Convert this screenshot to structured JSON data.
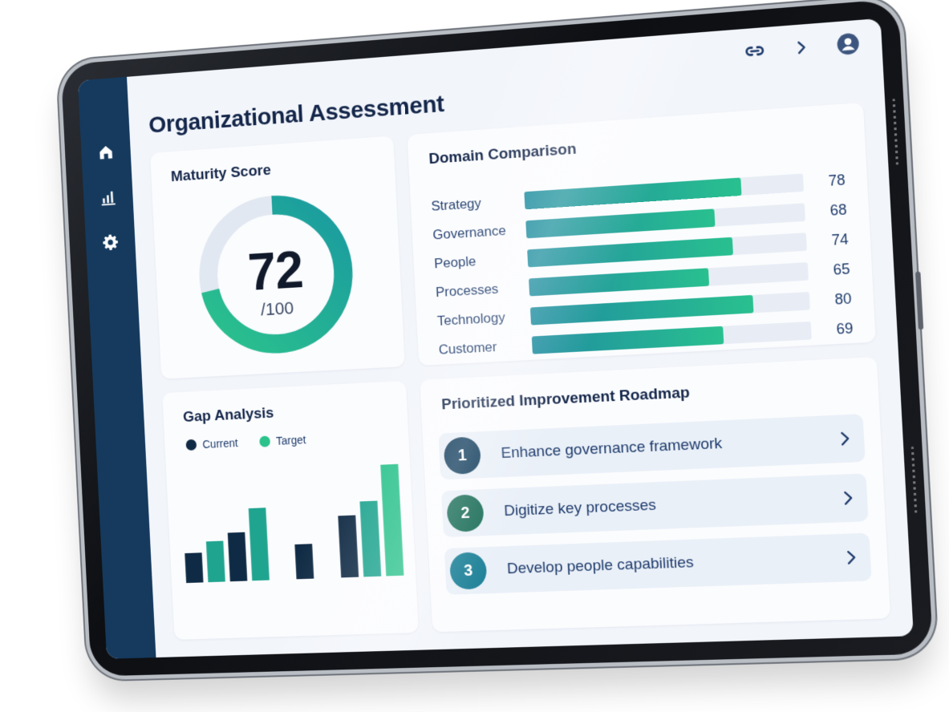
{
  "title": "Organizational Assessment",
  "nav": {
    "items": [
      {
        "name": "home",
        "icon": "home-icon"
      },
      {
        "name": "analytics",
        "icon": "bar-chart-icon"
      },
      {
        "name": "settings",
        "icon": "gear-icon"
      }
    ]
  },
  "topbar": {
    "icons": [
      "link-icon",
      "chevron-right-icon",
      "user-avatar-icon"
    ]
  },
  "maturity": {
    "title": "Maturity Score",
    "value": "72",
    "max_label": "/100",
    "fraction": 0.72
  },
  "domain": {
    "title": "Domain Comparison",
    "items": [
      {
        "label": "Strategy",
        "value": "78"
      },
      {
        "label": "Governance",
        "value": "68"
      },
      {
        "label": "People",
        "value": "74"
      },
      {
        "label": "Processes",
        "value": "65"
      },
      {
        "label": "Technology",
        "value": "80"
      },
      {
        "label": "Customer",
        "value": "69"
      }
    ]
  },
  "gap": {
    "title": "Gap Analysis",
    "legend_current": "Current",
    "legend_target": "Target"
  },
  "roadmap": {
    "title": "Prioritized Improvement Roadmap",
    "items": [
      {
        "number": "1",
        "text": "Enhance governance framework",
        "color": "#0e3a5a"
      },
      {
        "number": "2",
        "text": "Digitize key processes",
        "color": "#176b55"
      },
      {
        "number": "3",
        "text": "Develop people capabilities",
        "color": "#1a7f96"
      }
    ]
  },
  "colors": {
    "navy": "#153a5e",
    "teal": "#1fa48f",
    "green": "#2bc28c",
    "dark_bar": "#0f2a44"
  },
  "chart_data": {
    "type": "bar",
    "categories": [
      "",
      "",
      "",
      "",
      "",
      "",
      "",
      "",
      "",
      ""
    ],
    "series": [
      {
        "name": "Current",
        "values": [
          38,
          0,
          62,
          0,
          0,
          44,
          0,
          78,
          0,
          0
        ]
      },
      {
        "name": "Target",
        "values": [
          0,
          52,
          0,
          92,
          0,
          0,
          0,
          0,
          95,
          140
        ]
      }
    ],
    "ylim": [
      0,
      150
    ],
    "grid": false,
    "legend": "top-left"
  }
}
